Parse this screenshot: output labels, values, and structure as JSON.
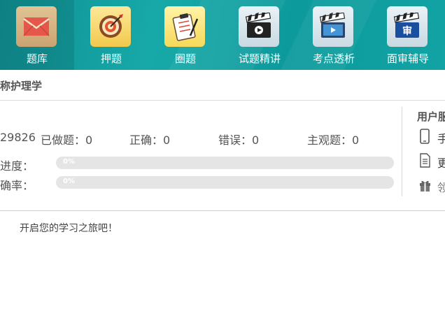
{
  "nav": {
    "items": [
      {
        "label": "题库",
        "icon": "envelope-icon"
      },
      {
        "label": "押题",
        "icon": "target-icon"
      },
      {
        "label": "圈题",
        "icon": "clipboard-icon"
      },
      {
        "label": "试题精讲",
        "icon": "clapperboard-icon"
      },
      {
        "label": "考点透析",
        "icon": "video-player-icon"
      },
      {
        "label": "面审辅导",
        "icon": "review-clapperboard-icon"
      }
    ],
    "review_char": "审"
  },
  "subject": {
    "title": "职称护理学"
  },
  "stats": {
    "id_fragment": "29826",
    "done": "已做题：0",
    "correct": "正确：0",
    "wrong": "错误：0",
    "subjective": "主观题：0"
  },
  "progress": {
    "label": "进度：",
    "value": 0,
    "text": "0%"
  },
  "accuracy": {
    "label": "确率：",
    "value": 0,
    "text": "0%"
  },
  "user_panel": {
    "title": "用户服",
    "items": [
      {
        "label": "手",
        "icon": "phone-icon"
      },
      {
        "label": "更",
        "icon": "document-icon"
      },
      {
        "label": "领",
        "icon": "gift-icon"
      }
    ]
  },
  "welcome": "开启您的学习之旅吧！",
  "colors": {
    "nav_bg": "#12a3a4",
    "bar_track": "#e5e5e5",
    "text": "#555555"
  }
}
